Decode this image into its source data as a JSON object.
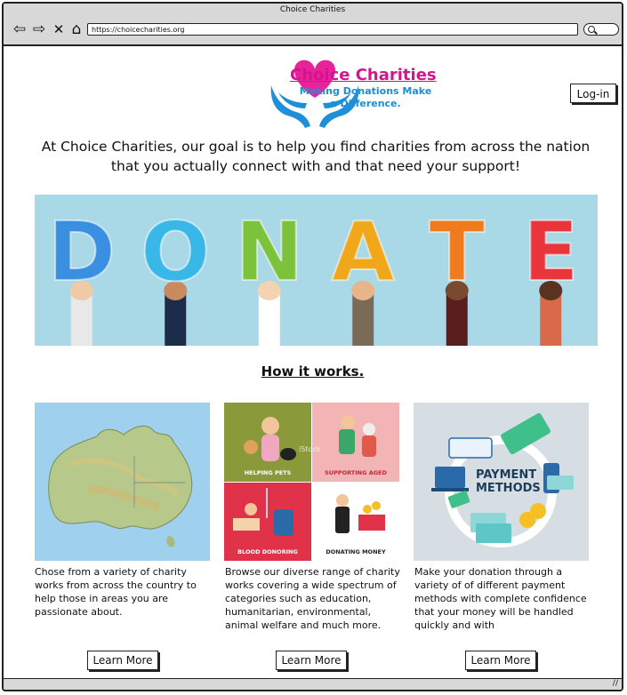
{
  "browser": {
    "window_title": "Choice Charities",
    "url": "https://choicecharities.org"
  },
  "header": {
    "brand_name": "Choice Charities",
    "tagline": "Making Donations Make a Difference.",
    "login_label": "Log-in"
  },
  "intro": {
    "text": "At Choice Charities, our goal is to help you find charities from across the nation that you actually connect with and that need your support!"
  },
  "banner": {
    "letters": [
      "D",
      "O",
      "N",
      "A",
      "T",
      "E"
    ],
    "letter_colors": [
      "#3a8fe0",
      "#39b7e6",
      "#7cc23a",
      "#f0a81a",
      "#f07a1e",
      "#e8363a"
    ]
  },
  "how_it_works": {
    "heading": "How it works."
  },
  "cards": [
    {
      "image": "australia-map",
      "text": "Chose from a variety of charity works from across the country to help those in areas you are passionate about.",
      "button": "Learn More"
    },
    {
      "image": "charity-categories",
      "tiles": [
        "HELPING PETS",
        "SUPPORTING AGED",
        "BLOOD DONORING",
        "DONATING MONEY"
      ],
      "watermark": "iStock",
      "text": "Browse our diverse range of charity works covering a wide spectrum of categories such as education, humanitarian, environmental, animal welfare and much more.",
      "button": "Learn More"
    },
    {
      "image": "payment-methods",
      "image_caption": "PAYMENT METHODS",
      "text": "Make your donation through a variety of of different payment methods with complete confidence that your money will be handled quickly and with",
      "button": "Learn More"
    }
  ],
  "colors": {
    "brand_pink": "#d4148c",
    "brand_blue": "#1a8fd6",
    "banner_bg": "#a9d8e6"
  }
}
